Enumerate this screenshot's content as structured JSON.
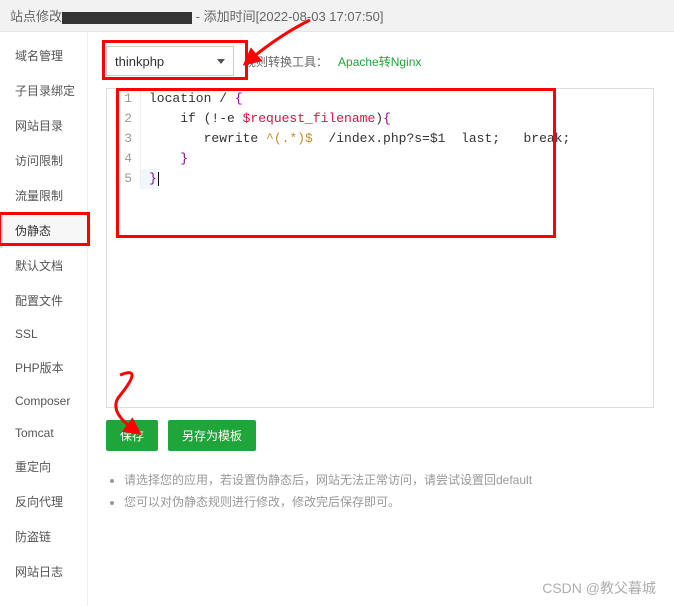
{
  "header": {
    "prefix": "站点修改",
    "suffix": " - 添加时间[2022-08-03 17:07:50]"
  },
  "sidebar": {
    "items": [
      {
        "label": "域名管理"
      },
      {
        "label": "子目录绑定"
      },
      {
        "label": "网站目录"
      },
      {
        "label": "访问限制"
      },
      {
        "label": "流量限制"
      },
      {
        "label": "伪静态",
        "active": true
      },
      {
        "label": "默认文档"
      },
      {
        "label": "配置文件"
      },
      {
        "label": "SSL"
      },
      {
        "label": "PHP版本"
      },
      {
        "label": "Composer"
      },
      {
        "label": "Tomcat"
      },
      {
        "label": "重定向"
      },
      {
        "label": "反向代理"
      },
      {
        "label": "防盗链"
      },
      {
        "label": "网站日志"
      }
    ]
  },
  "toolbar": {
    "select_value": "thinkphp",
    "convert_label": "规则转换工具：",
    "convert_link": "Apache转Nginx"
  },
  "editor": {
    "lines": [
      {
        "n": "1",
        "tokens": [
          "location / ",
          "{"
        ]
      },
      {
        "n": "2",
        "tokens": [
          "    if (!-e ",
          "$request_filename",
          ")",
          "{"
        ]
      },
      {
        "n": "3",
        "tokens": [
          "       rewrite ",
          "^(.*)$",
          "  /index.php?s=$1  last;   break;"
        ]
      },
      {
        "n": "4",
        "tokens": [
          "    ",
          "}"
        ]
      },
      {
        "n": "5",
        "tokens": [
          "}",
          ""
        ],
        "active": true
      }
    ]
  },
  "actions": {
    "save": "保存",
    "save_as": "另存为模板"
  },
  "hints": [
    "请选择您的应用，若设置伪静态后，网站无法正常访问，请尝试设置回default",
    "您可以对伪静态规则进行修改，修改完后保存即可。"
  ],
  "watermark": "CSDN @教父暮城"
}
